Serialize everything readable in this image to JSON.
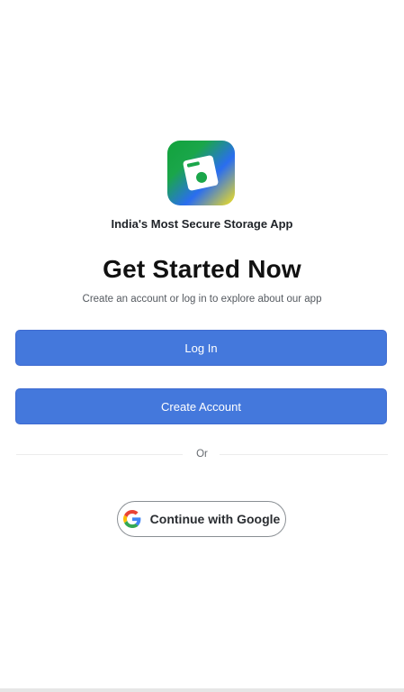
{
  "app": {
    "tagline": "India's Most Secure Storage App",
    "logo_icon": "floppy-disk-icon"
  },
  "hero": {
    "title": "Get Started Now",
    "subtitle": "Create an account or log in to explore about our app"
  },
  "actions": {
    "login_label": "Log In",
    "create_account_label": "Create Account",
    "divider_text": "Or",
    "google_label": "Continue with Google",
    "google_icon": "google-g-icon"
  },
  "colors": {
    "primary": "#4478dc",
    "title": "#111111",
    "muted": "#555a60"
  }
}
